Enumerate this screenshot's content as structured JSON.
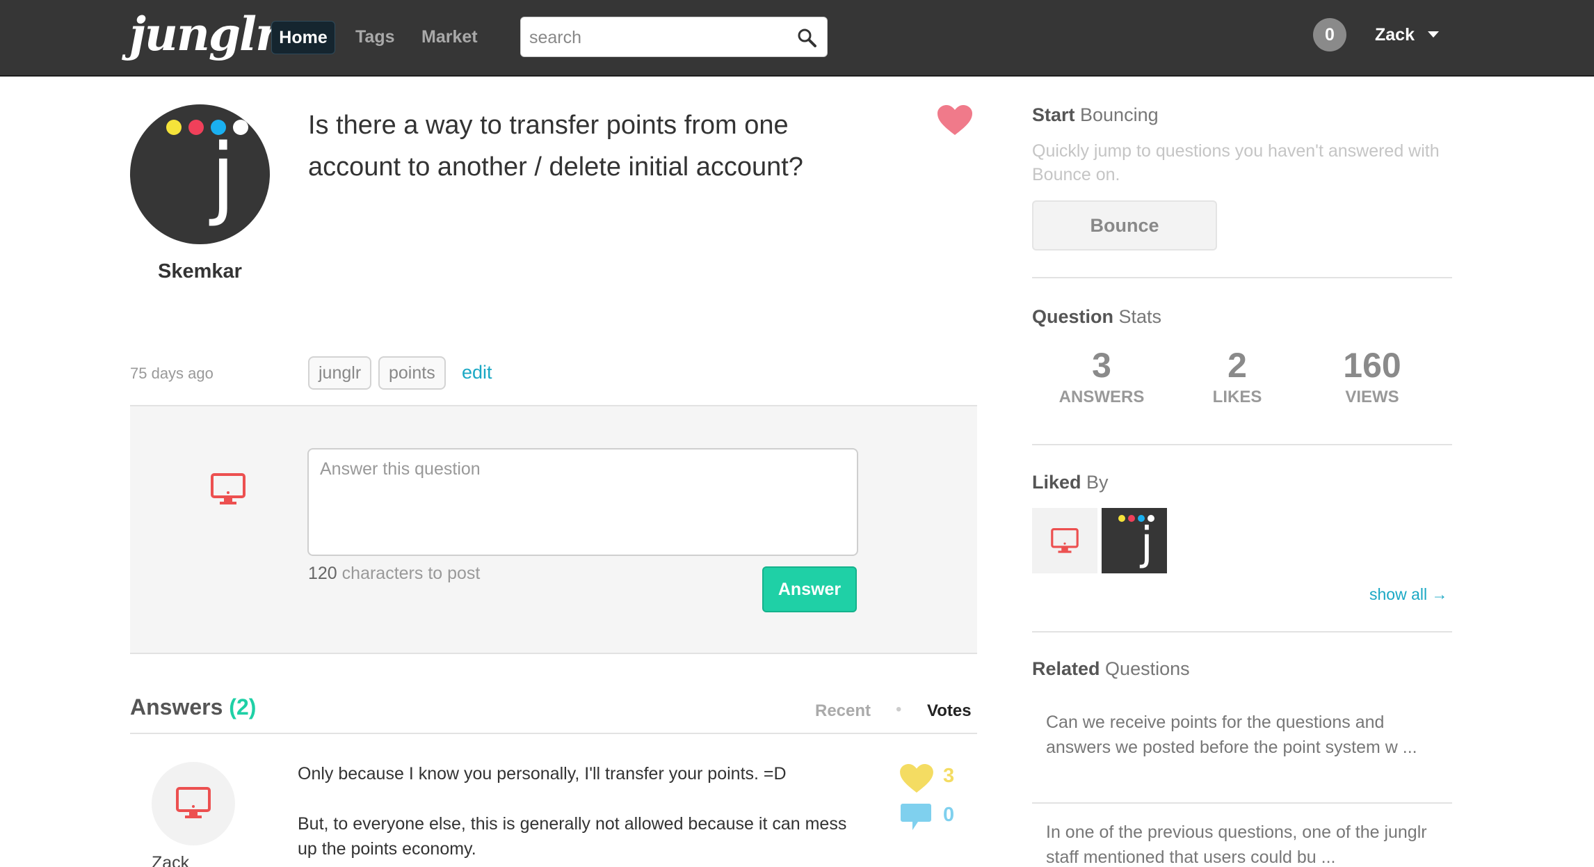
{
  "nav": {
    "logo": "junglr",
    "home_label": "Home",
    "tags_label": "Tags",
    "market_label": "Market",
    "search_placeholder": "search",
    "points": "0",
    "user_name": "Zack"
  },
  "question": {
    "author": "Skemkar",
    "title": "Is there a way to transfer points from one account to another / delete initial account?",
    "time_ago": "75 days ago",
    "tags": [
      "junglr",
      "points"
    ],
    "edit_label": "edit"
  },
  "answer_form": {
    "placeholder": "Answer this question",
    "char_count": "120",
    "char_suffix": " characters to post",
    "button_label": "Answer"
  },
  "answers": {
    "heading": "Answers",
    "count": "(2)",
    "sort_recent": "Recent",
    "sort_separator": "•",
    "sort_votes": "Votes",
    "items": [
      {
        "user": "Zack",
        "paragraphs": [
          "Only because I know you personally, I'll transfer your points. =D",
          "But, to everyone else, this is generally not allowed because it can mess up the points economy."
        ],
        "likes": "3",
        "comments": "0"
      }
    ]
  },
  "sidebar": {
    "bounce": {
      "heading_bold": "Start",
      "heading_rest": " Bouncing",
      "description": "Quickly jump to questions you haven't answered with Bounce on.",
      "button_label": "Bounce"
    },
    "stats": {
      "heading_bold": "Question",
      "heading_rest": " Stats",
      "answers_value": "3",
      "answers_label": "ANSWERS",
      "likes_value": "2",
      "likes_label": "LIKES",
      "views_value": "160",
      "views_label": "VIEWS"
    },
    "liked_by": {
      "heading_bold": "Liked",
      "heading_rest": " By",
      "show_all": "show all →"
    },
    "related": {
      "heading_bold": "Related",
      "heading_rest": " Questions",
      "items": [
        "Can we receive points for the questions and answers we posted before the point system w ...",
        "In one of the previous questions, one of the junglr staff mentioned that users could bu ..."
      ]
    }
  },
  "colors": {
    "nav_bg": "#363636",
    "accent_teal": "#1fd0a6",
    "link_blue": "#1aa8c4",
    "heart_pink": "#f07a8a",
    "like_yellow": "#f4dc62",
    "comment_blue": "#7fd0ee",
    "monitor_red": "#ec5050",
    "avatar_dots": [
      "#f5e33a",
      "#f0405a",
      "#1ab0f0",
      "#ffffff"
    ]
  },
  "icons": {
    "search": "search-icon",
    "heart": "heart-icon",
    "monitor": "monitor-icon",
    "like": "heart-like-icon",
    "comment": "speech-bubble-icon",
    "caret": "caret-down-icon"
  }
}
